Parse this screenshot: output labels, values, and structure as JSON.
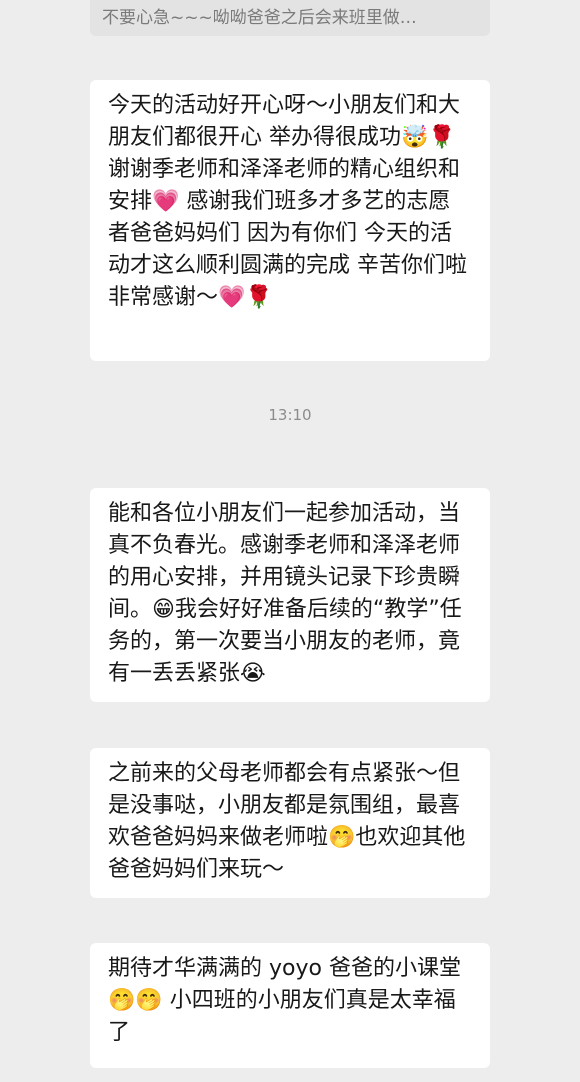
{
  "quote": {
    "text": "不要心急~~~呦呦爸爸之后会来班里做…"
  },
  "messages": [
    {
      "text": "今天的活动好开心呀～小朋友们和大朋友们都很开心 举办得很成功🤯🌹谢谢季老师和泽泽老师的精心组织和安排💗 感谢我们班多才多艺的志愿者爸爸妈妈们 因为有你们 今天的活动才这么顺利圆满的完成 辛苦你们啦 非常感谢～💗🌹"
    },
    {
      "text": "能和各位小朋友们一起参加活动，当真不负春光。感谢季老师和泽泽老师的用心安排，并用镜头记录下珍贵瞬间。😁我会好好准备后续的“教学”任务的，第一次要当小朋友的老师，竟有一丢丢紧张😭"
    },
    {
      "text": "之前来的父母老师都会有点紧张～但是没事哒，小朋友都是氛围组，最喜欢爸爸妈妈来做老师啦🤭也欢迎其他爸爸妈妈们来玩～"
    },
    {
      "text": "期待才华满满的 yoyo 爸爸的小课堂🤭🤭 小四班的小朋友们真是太幸福了"
    }
  ],
  "timestamp": "13:10"
}
